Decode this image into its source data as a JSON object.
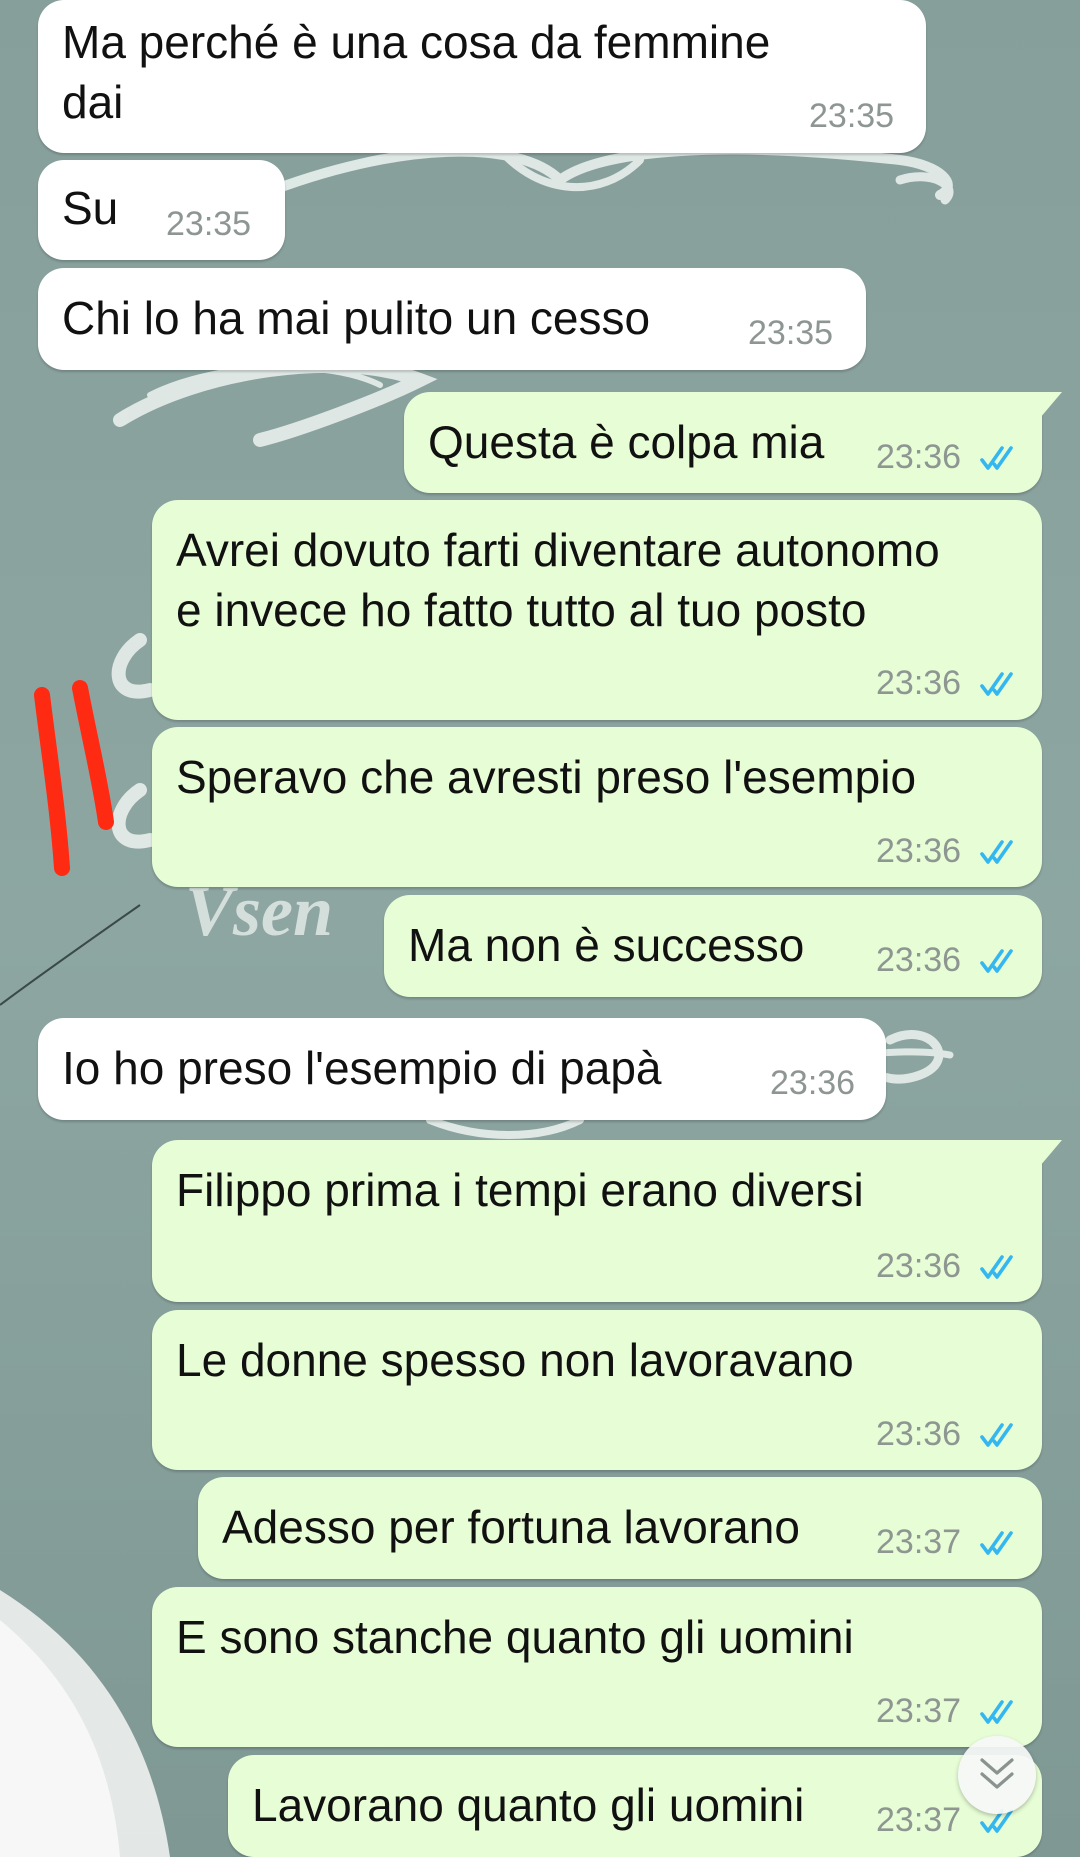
{
  "colors": {
    "incoming_bubble": "#ffffff",
    "outgoing_bubble": "#e7fdd6",
    "timestamp": "#8e9692",
    "read_ticks": "#34b7f1",
    "wallpaper": "#8aa39f",
    "annotation_marks": "#ff2a12"
  },
  "wallpaper": {
    "fragment_text": "Vsen"
  },
  "messages": [
    {
      "direction": "incoming",
      "text": "Ma perché è una cosa da femmine\ndai",
      "time": "23:35"
    },
    {
      "direction": "incoming",
      "text": "Su",
      "time": "23:35"
    },
    {
      "direction": "incoming",
      "text": "Chi lo ha mai pulito un cesso",
      "time": "23:35"
    },
    {
      "direction": "outgoing",
      "text": "Questa è colpa mia",
      "time": "23:36",
      "status": "read-double-tick-icon"
    },
    {
      "direction": "outgoing",
      "text": "Avrei dovuto farti diventare autonomo\ne invece ho fatto tutto al tuo posto",
      "time": "23:36",
      "status": "read-double-tick-icon"
    },
    {
      "direction": "outgoing",
      "text": "Speravo che avresti preso l'esempio",
      "time": "23:36",
      "status": "read-double-tick-icon"
    },
    {
      "direction": "outgoing",
      "text": "Ma non è successo",
      "time": "23:36",
      "status": "read-double-tick-icon"
    },
    {
      "direction": "incoming",
      "text": "Io ho preso l'esempio di papà",
      "time": "23:36"
    },
    {
      "direction": "outgoing",
      "text": "Filippo prima i tempi erano diversi",
      "time": "23:36",
      "status": "read-double-tick-icon"
    },
    {
      "direction": "outgoing",
      "text": "Le donne spesso non lavoravano",
      "time": "23:36",
      "status": "read-double-tick-icon"
    },
    {
      "direction": "outgoing",
      "text": "Adesso per fortuna lavorano",
      "time": "23:37",
      "status": "read-double-tick-icon"
    },
    {
      "direction": "outgoing",
      "text": "E sono stanche quanto gli uomini",
      "time": "23:37",
      "status": "read-double-tick-icon"
    },
    {
      "direction": "outgoing",
      "text": "Lavorano quanto gli uomini",
      "time": "23:37",
      "status": "read-double-tick-icon"
    }
  ],
  "scroll_button": {
    "icon": "double-chevron-down-icon"
  }
}
